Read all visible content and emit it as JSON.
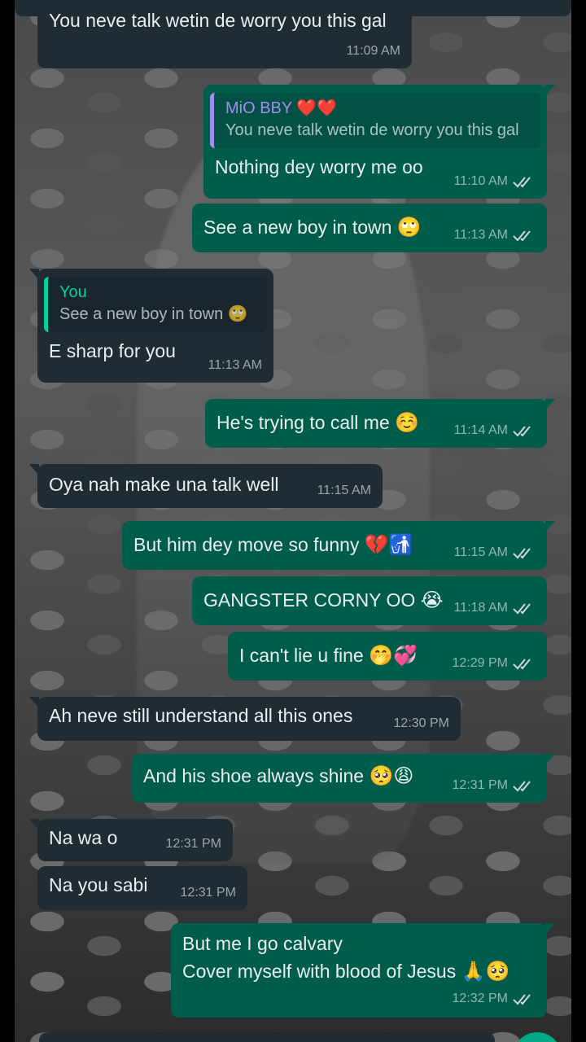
{
  "messages": [
    {
      "id": "m1",
      "dir": "in",
      "text": "You neve talk wetin de worry you this gal",
      "time": "11:09 AM"
    },
    {
      "id": "m2",
      "dir": "out",
      "quote": {
        "author": "MiO BBY ❤️❤️",
        "text": "You neve talk wetin de worry you this gal"
      },
      "text": "Nothing dey worry me oo",
      "time": "11:10 AM"
    },
    {
      "id": "m3",
      "dir": "out",
      "text": "See a new boy in town",
      "emoji": "🙄",
      "time": "11:13 AM"
    },
    {
      "id": "m4",
      "dir": "in",
      "quote": {
        "author": "You",
        "text": "See a new boy in town 🙄"
      },
      "text": "E sharp for you",
      "time": "11:13 AM"
    },
    {
      "id": "m5",
      "dir": "out",
      "text": "He's trying to call me",
      "emoji": "☺️",
      "time": "11:14 AM"
    },
    {
      "id": "m6",
      "dir": "in",
      "text": "Oya nah make una talk well",
      "time": "11:15 AM"
    },
    {
      "id": "m7",
      "dir": "out",
      "text": "But him dey move so funny",
      "emoji": "💔🚮",
      "time": "11:15 AM"
    },
    {
      "id": "m8",
      "dir": "out",
      "text": "GANGSTER CORNY OO",
      "emoji": "😭",
      "time": "11:18 AM"
    },
    {
      "id": "m9",
      "dir": "out",
      "text": "I can't lie u fine",
      "emoji": "🤭💞",
      "time": "12:29 PM"
    },
    {
      "id": "m10",
      "dir": "in",
      "text": "Ah neve still understand all this ones",
      "time": "12:30 PM"
    },
    {
      "id": "m11",
      "dir": "out",
      "text": "And his shoe always shine",
      "emoji": "🥺😩",
      "time": "12:31 PM"
    },
    {
      "id": "m12",
      "dir": "in",
      "text": "Na wa o",
      "time": "12:31 PM"
    },
    {
      "id": "m13",
      "dir": "in",
      "text": "Na you sabi",
      "time": "12:31 PM"
    },
    {
      "id": "m14",
      "dir": "out",
      "text": "But me I go calvary\nCover myself with blood of Jesus",
      "emoji": "🙏🥺",
      "time": "12:32 PM"
    }
  ],
  "colors": {
    "incoming_bubble": "#1f2c34",
    "outgoing_bubble": "#005c4b",
    "read_ticks": "#d1d7db",
    "quote_accent_out": "#a58cf0",
    "quote_accent_in": "#06cf9c"
  },
  "icons": {
    "read_receipt": "double-check-icon"
  }
}
